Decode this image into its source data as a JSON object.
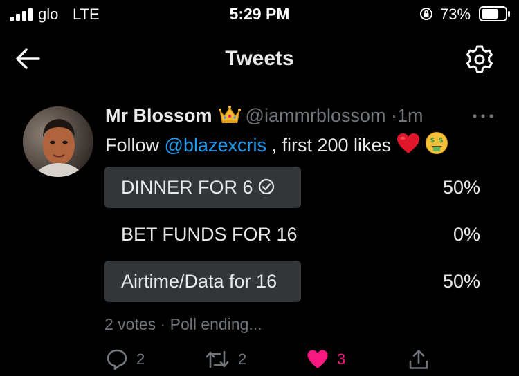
{
  "status_bar": {
    "carrier": "glo",
    "network": "LTE",
    "time": "5:29 PM",
    "battery_percent": "73%",
    "battery_level": 0.73
  },
  "header": {
    "title": "Tweets",
    "back_icon": "arrow-left-icon",
    "settings_icon": "gear-icon"
  },
  "tweet": {
    "display_name": "Mr Blossom",
    "name_emoji": "crown",
    "handle": "@iammrblossom",
    "separator": "·",
    "timestamp": "1m",
    "text_before": "Follow ",
    "mention": "@blazexcris",
    "text_after": " , first 200 likes",
    "emojis": [
      "red-heart",
      "money-mouth-face"
    ]
  },
  "poll": {
    "options": [
      {
        "label": "DINNER FOR 6",
        "percent": "50%",
        "fraction": 0.5,
        "voted": true
      },
      {
        "label": "BET FUNDS FOR 16",
        "percent": "0%",
        "fraction": 0,
        "voted": false
      },
      {
        "label": "Airtime/Data for 16",
        "percent": "50%",
        "fraction": 0.5,
        "voted": false
      }
    ],
    "votes": "2 votes",
    "separator": "·",
    "status": "Poll ending..."
  },
  "actions": {
    "reply_count": "2",
    "retweet_count": "2",
    "like_count": "3",
    "liked": true
  },
  "colors": {
    "background": "#000000",
    "text": "#e7e9ea",
    "secondary": "#71767b",
    "link": "#1d9bf0",
    "like": "#f91880",
    "poll_fill": "#333639"
  }
}
